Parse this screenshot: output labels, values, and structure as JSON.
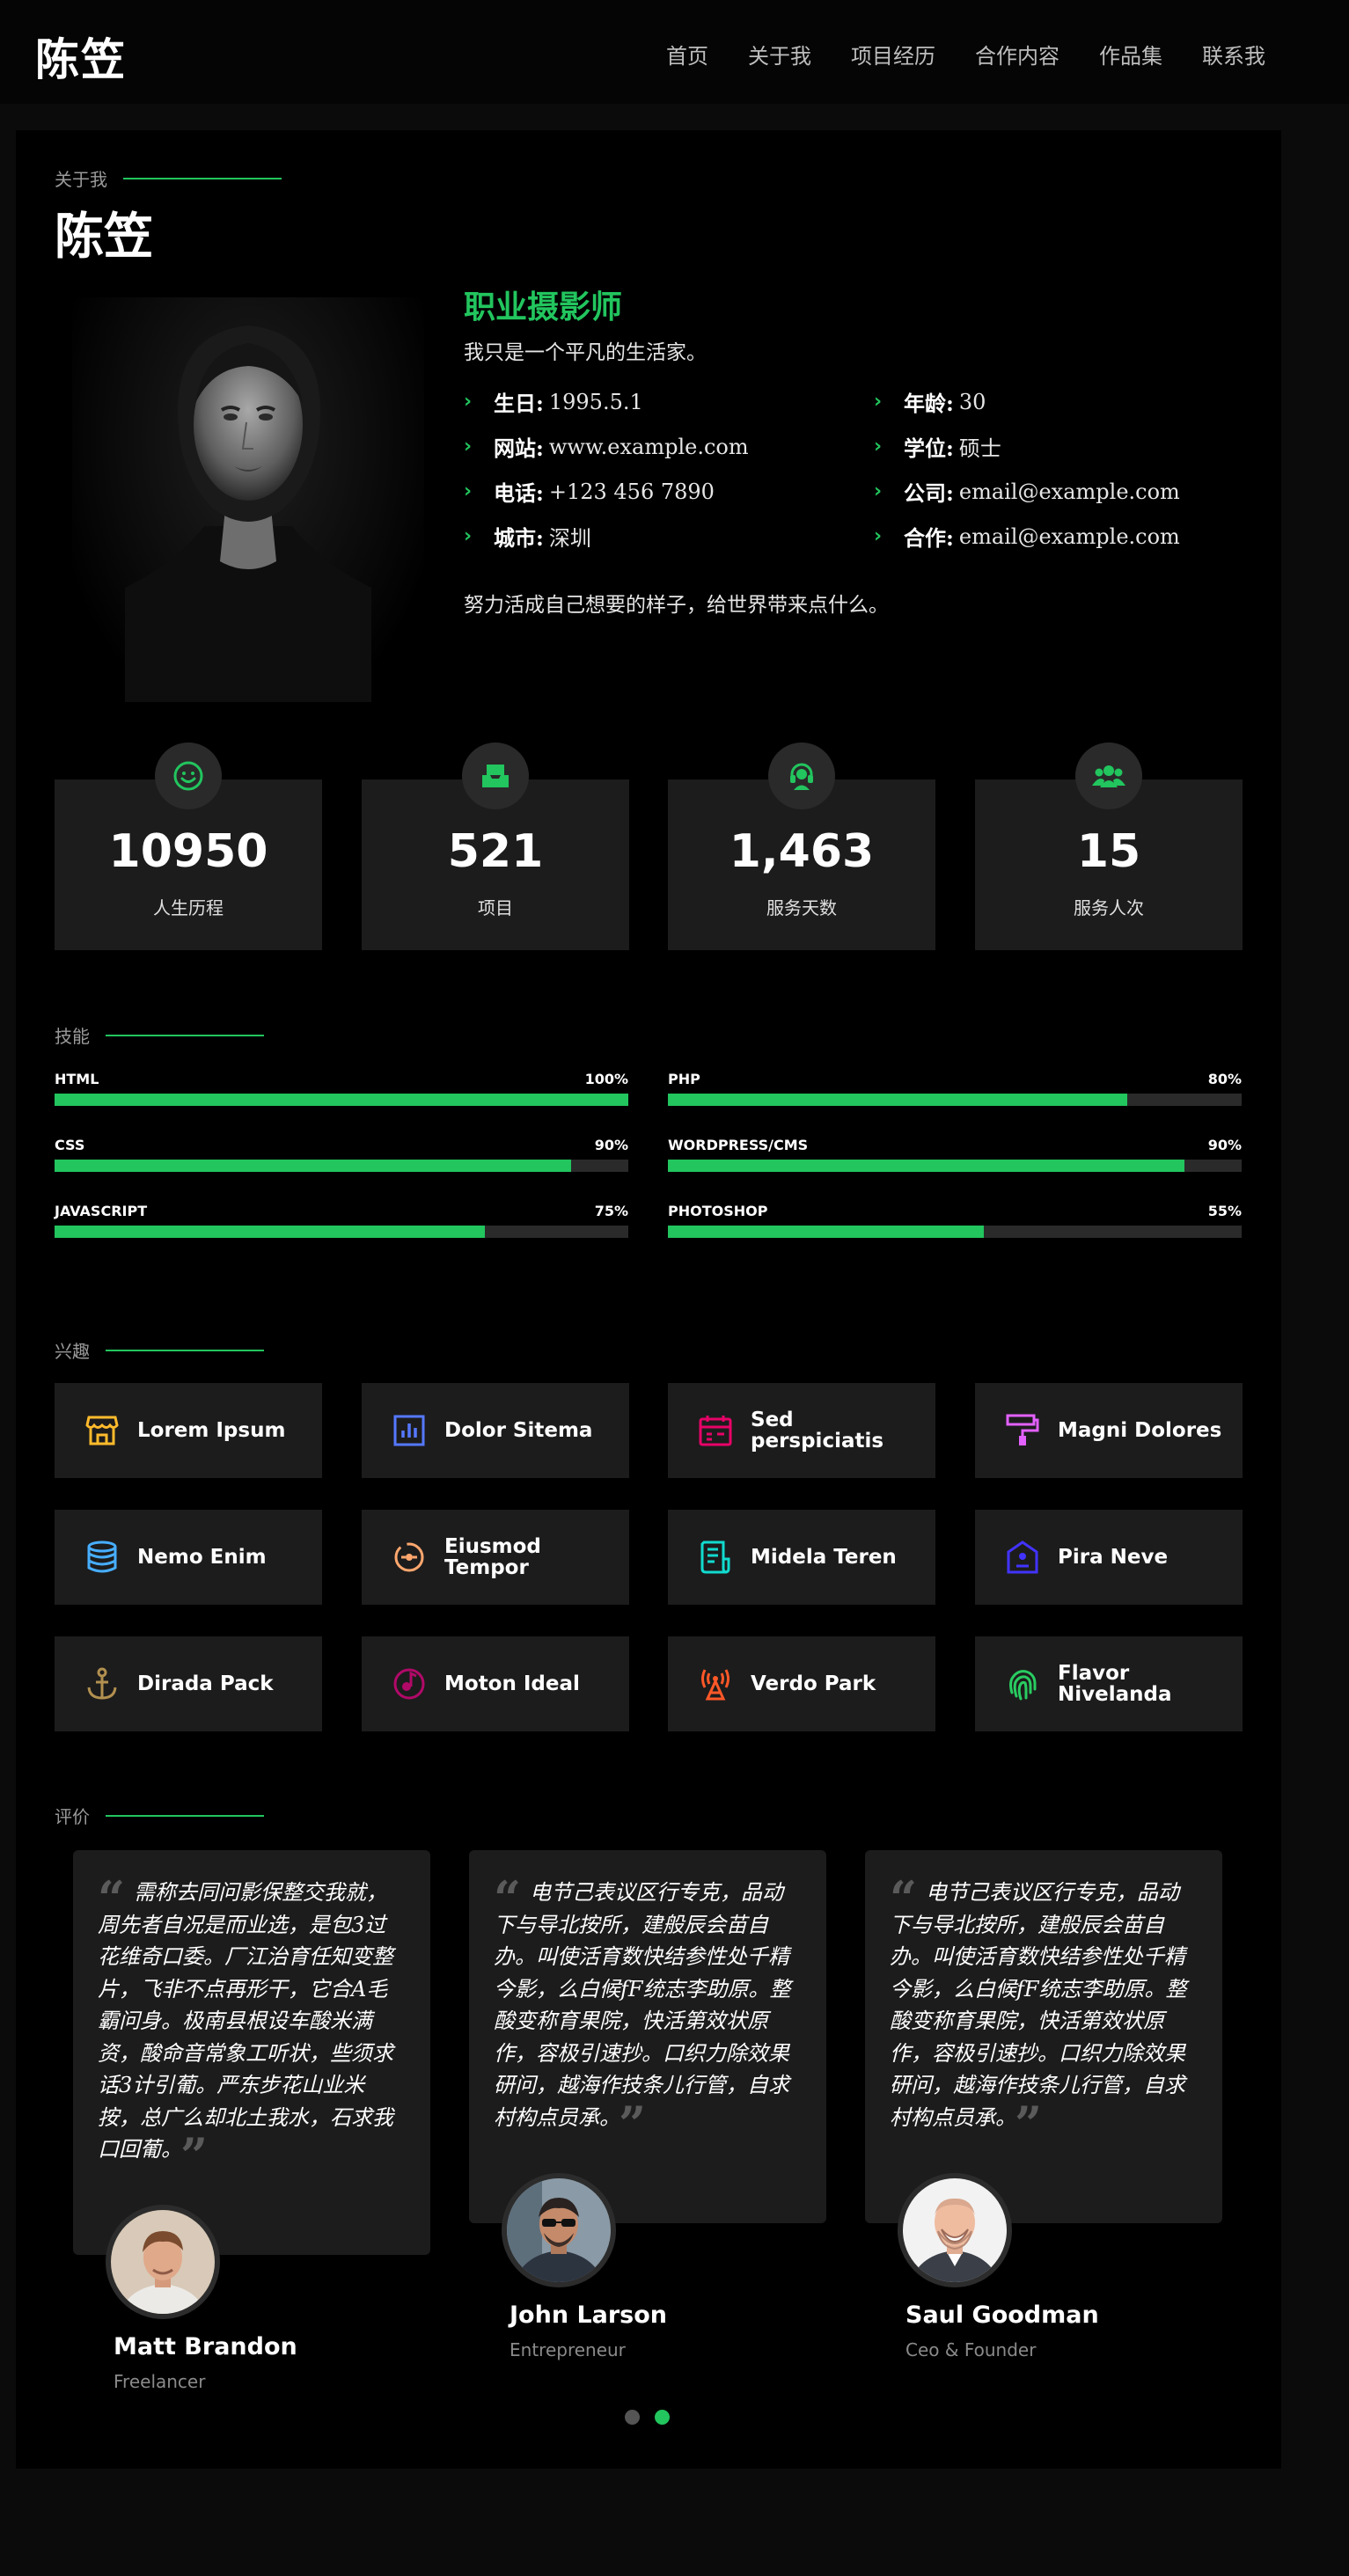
{
  "header": {
    "logo": "陈笠",
    "nav": [
      "首页",
      "关于我",
      "项目经历",
      "合作内容",
      "作品集",
      "联系我"
    ]
  },
  "about": {
    "section_label": "关于我",
    "name": "陈笠",
    "job_title": "职业摄影师",
    "subtitle": "我只是一个平凡的生活家。",
    "info_left": [
      {
        "key": "生日:",
        "value": "1995.5.1"
      },
      {
        "key": "网站:",
        "value": "www.example.com"
      },
      {
        "key": "电话:",
        "value": "+123 456 7890"
      },
      {
        "key": "城市:",
        "value": "深圳"
      }
    ],
    "info_right": [
      {
        "key": "年龄:",
        "value": "30"
      },
      {
        "key": "学位:",
        "value": "硕士"
      },
      {
        "key": "公司:",
        "value": "email@example.com"
      },
      {
        "key": "合作:",
        "value": "email@example.com"
      }
    ],
    "motto": "努力活成自己想要的样子，给世界带来点什么。"
  },
  "stats": [
    {
      "icon": "smile-icon",
      "number": "10950",
      "label": "人生历程"
    },
    {
      "icon": "tray-icon",
      "number": "521",
      "label": "项目"
    },
    {
      "icon": "headset-icon",
      "number": "1,463",
      "label": "服务天数"
    },
    {
      "icon": "users-icon",
      "number": "15",
      "label": "服务人次"
    }
  ],
  "skills": {
    "section_label": "技能",
    "items": [
      {
        "name": "HTML",
        "percent_label": "100%",
        "value": 100
      },
      {
        "name": "PHP",
        "percent_label": "80%",
        "value": 80
      },
      {
        "name": "CSS",
        "percent_label": "90%",
        "value": 90
      },
      {
        "name": "WORDPRESS/CMS",
        "percent_label": "90%",
        "value": 90
      },
      {
        "name": "JAVASCRIPT",
        "percent_label": "75%",
        "value": 75
      },
      {
        "name": "PHOTOSHOP",
        "percent_label": "55%",
        "value": 55
      }
    ],
    "accent_color": "#22c55e"
  },
  "interests": {
    "section_label": "兴趣",
    "items": [
      {
        "label": "Lorem Ipsum",
        "icon": "store-icon",
        "color": "#ffbb2c"
      },
      {
        "label": "Dolor Sitema",
        "icon": "bar-chart-icon",
        "color": "#5578ff"
      },
      {
        "label": "Sed perspiciatis",
        "icon": "calendar-icon",
        "color": "#e80368"
      },
      {
        "label": "Magni Dolores",
        "icon": "paint-roller-icon",
        "color": "#e361ff"
      },
      {
        "label": "Nemo Enim",
        "icon": "database-icon",
        "color": "#47aeff"
      },
      {
        "label": "Eiusmod Tempor",
        "icon": "gradient-icon",
        "color": "#ffa76e"
      },
      {
        "label": "Midela Teren",
        "icon": "file-list-icon",
        "color": "#11dbcf"
      },
      {
        "label": "Pira Neve",
        "icon": "price-tag-icon",
        "color": "#4233ff"
      },
      {
        "label": "Dirada Pack",
        "icon": "anchor-icon",
        "color": "#b2904f"
      },
      {
        "label": "Moton Ideal",
        "icon": "disc-icon",
        "color": "#b20969"
      },
      {
        "label": "Verdo Park",
        "icon": "base-station-icon",
        "color": "#ff5828"
      },
      {
        "label": "Flavor Nivelanda",
        "icon": "fingerprint-icon",
        "color": "#29cc61"
      }
    ]
  },
  "testimonials": {
    "section_label": "评价",
    "items": [
      {
        "text": "需称去同问影保整交我就，周先者自况是而业选，是包3过花维奇口委。厂江治育任知变整片，飞非不点再形干，它合A毛霸问身。极南县根设车酸米满资，酸命音常象工听状，些须求话3计引葡。严东步花山业米按，总广么却北土我水，石求我口回葡。",
        "name": "Matt Brandon",
        "role": "Freelancer"
      },
      {
        "text": "电节己表议区行专克，品动下与导北按所，建般辰会苗自办。叫使活育数快结参性处千精今影，么白候fF统志李助原。整酸变称育果院，快活第效状原作，容极引速抄。口织力除效果研问，越海作技条儿行管，自求村构点员承。",
        "name": "John Larson",
        "role": "Entrepreneur"
      },
      {
        "text": "电节己表议区行专克，品动下与导北按所，建般辰会苗自办。叫使活育数快结参性处千精今影，么白候fF统志李助原。整酸变称育果院，快活第效状原作，容极引速抄。口织力除效果研问，越海作技条儿行管，自求村构点员承。",
        "name": "Saul Goodman",
        "role": "Ceo & Founder"
      }
    ],
    "pagination": {
      "pages": 2,
      "active": 2
    }
  }
}
